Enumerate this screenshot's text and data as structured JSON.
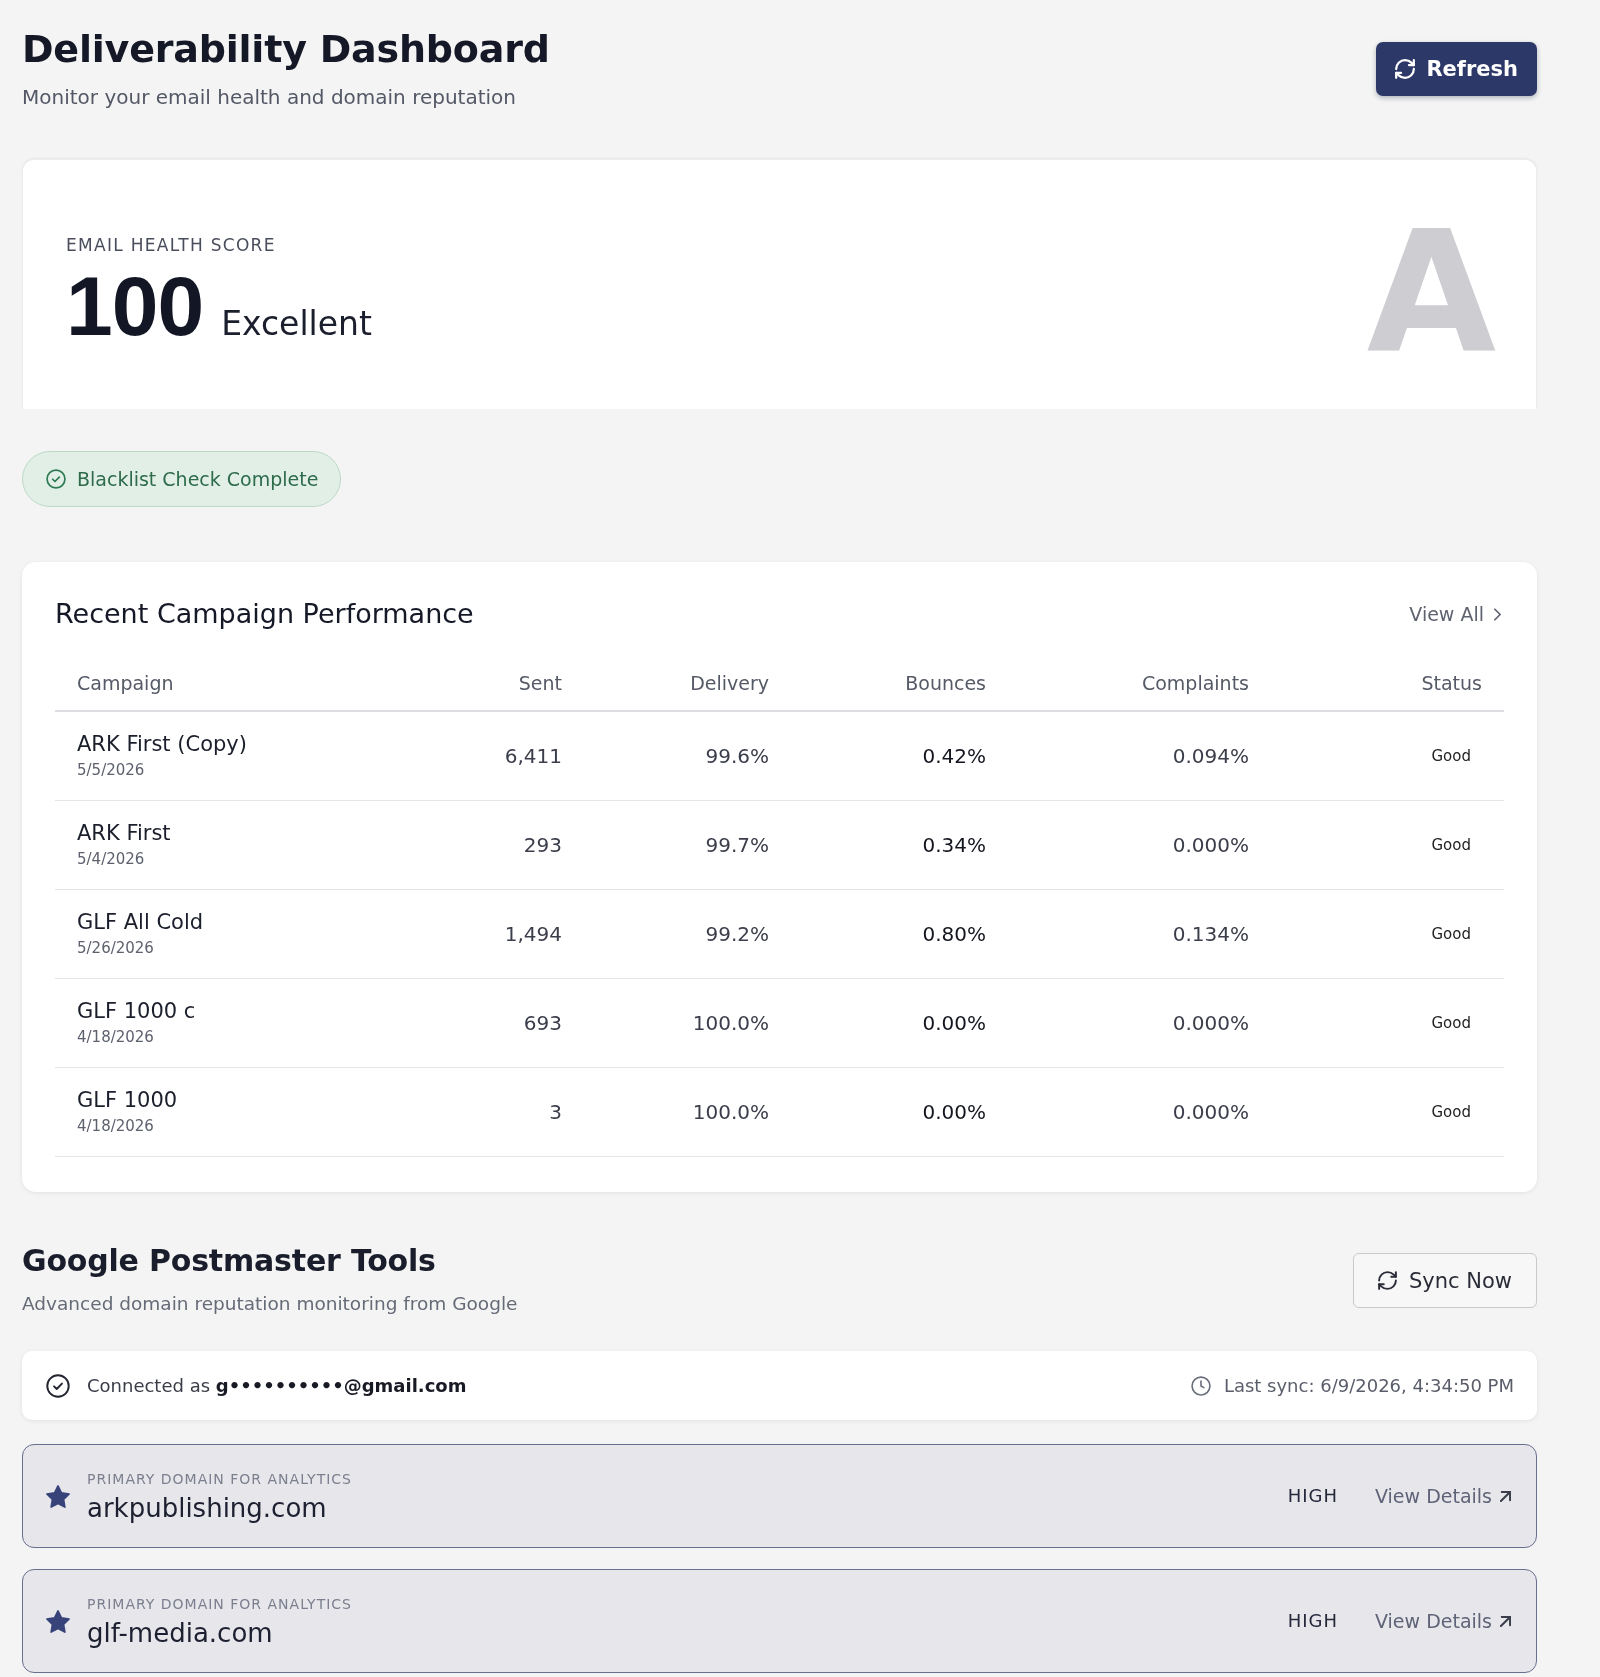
{
  "header": {
    "title": "Deliverability Dashboard",
    "subtitle": "Monitor your email health and domain reputation",
    "refresh_button": "Refresh"
  },
  "health_score": {
    "label": "EMAIL HEALTH SCORE",
    "score": "100",
    "rating": "Excellent",
    "grade": "A"
  },
  "blacklist_status": "Blacklist Check Complete",
  "campaigns": {
    "title": "Recent Campaign Performance",
    "view_all": "View All",
    "columns": [
      "Campaign",
      "Sent",
      "Delivery",
      "Bounces",
      "Complaints",
      "Status"
    ],
    "rows": [
      {
        "name": "ARK First (Copy)",
        "date": "5/5/2026",
        "sent": "6,411",
        "delivery": "99.6%",
        "bounces": "0.42%",
        "complaints": "0.094%",
        "status": "Good"
      },
      {
        "name": "ARK First",
        "date": "5/4/2026",
        "sent": "293",
        "delivery": "99.7%",
        "bounces": "0.34%",
        "complaints": "0.000%",
        "status": "Good"
      },
      {
        "name": "GLF All Cold",
        "date": "5/26/2026",
        "sent": "1,494",
        "delivery": "99.2%",
        "bounces": "0.80%",
        "complaints": "0.134%",
        "status": "Good"
      },
      {
        "name": "GLF 1000 c",
        "date": "4/18/2026",
        "sent": "693",
        "delivery": "100.0%",
        "bounces": "0.00%",
        "complaints": "0.000%",
        "status": "Good"
      },
      {
        "name": "GLF 1000",
        "date": "4/18/2026",
        "sent": "3",
        "delivery": "100.0%",
        "bounces": "0.00%",
        "complaints": "0.000%",
        "status": "Good"
      }
    ]
  },
  "postmaster": {
    "title": "Google Postmaster Tools",
    "subtitle": "Advanced domain reputation monitoring from Google",
    "sync_button": "Sync Now",
    "connection": {
      "text": "Connected as **g••••••••••@gmail.com**",
      "last_sync": "Last sync: 6/9/2026, 4:34:50 PM"
    },
    "domains": [
      {
        "label": "PRIMARY DOMAIN FOR ANALYTICS",
        "domain": "arkpublishing.com",
        "reputation": "HIGH",
        "link": "View Details"
      },
      {
        "label": "PRIMARY DOMAIN FOR ANALYTICS",
        "domain": "glf-media.com",
        "reputation": "HIGH",
        "link": "View Details"
      }
    ]
  }
}
